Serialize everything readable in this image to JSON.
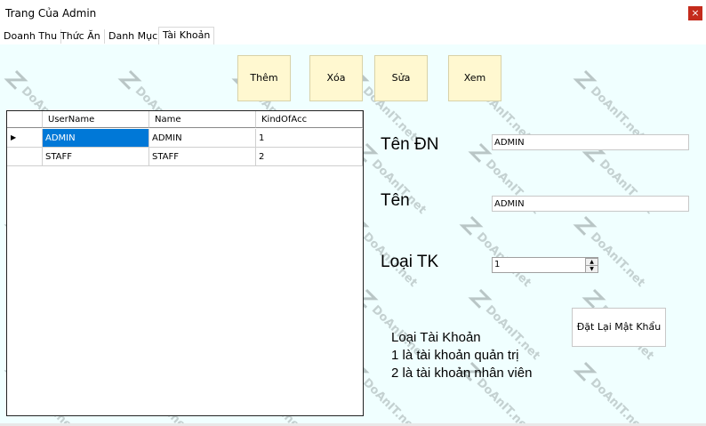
{
  "window": {
    "title": "Trang Của Admin",
    "close_glyph": "×"
  },
  "tabs": [
    {
      "label": "Doanh Thu"
    },
    {
      "label": "Thức Ăn"
    },
    {
      "label": "Danh Mục"
    },
    {
      "label": "Tài Khoản"
    }
  ],
  "toolbar": {
    "add_label": "Thêm",
    "delete_label": "Xóa",
    "edit_label": "Sửa",
    "view_label": "Xem"
  },
  "grid": {
    "columns": [
      "UserName",
      "Name",
      "KindOfAcc"
    ],
    "rows": [
      {
        "username": "ADMIN",
        "name": "ADMIN",
        "kind": "1"
      },
      {
        "username": "STAFF",
        "name": "STAFF",
        "kind": "2"
      }
    ],
    "current_row_glyph": "▶"
  },
  "form": {
    "username_label": "Tên ĐN",
    "username_value": "ADMIN",
    "name_label": "Tên",
    "name_value": "ADMIN",
    "type_label": "Loại TK",
    "type_value": "1"
  },
  "reset_password_label": "Đặt Lại Mật Khẩu",
  "legend": {
    "title": "Loại Tài Khoản",
    "line1": "1 là tài khoản quản trị",
    "line2": "2 là tài khoản nhân viên"
  },
  "watermark": {
    "text": "DoAnIT.net"
  }
}
